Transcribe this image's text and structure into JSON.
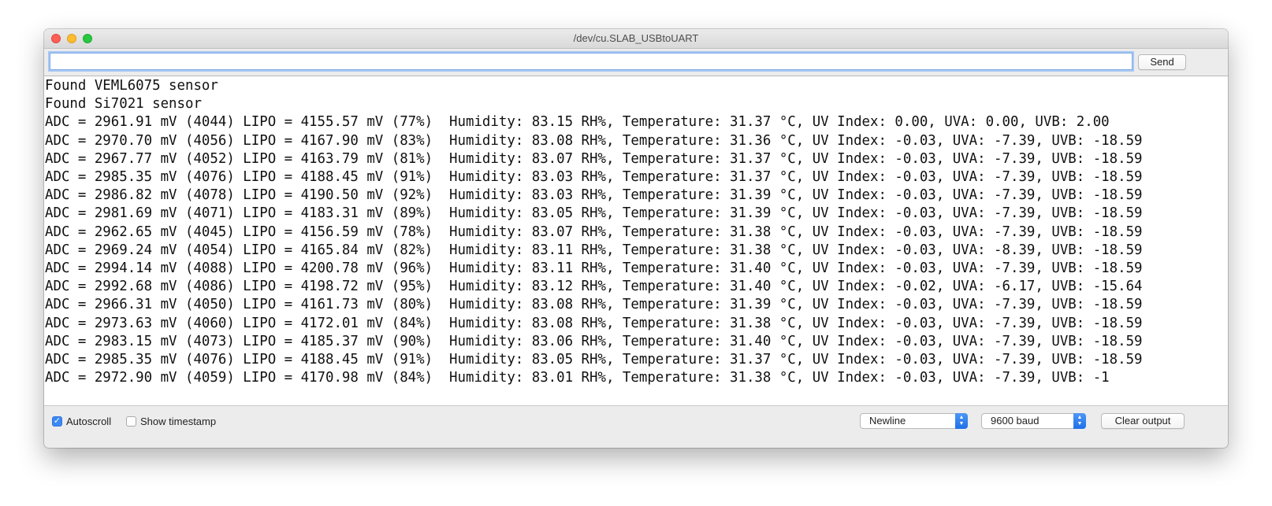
{
  "window": {
    "title": "/dev/cu.SLAB_USBtoUART"
  },
  "send_bar": {
    "input_value": "",
    "send_label": "Send"
  },
  "console": {
    "lines": [
      "Found VEML6075 sensor",
      "Found Si7021 sensor",
      "ADC = 2961.91 mV (4044) LIPO = 4155.57 mV (77%)  Humidity: 83.15 RH%, Temperature: 31.37 °C, UV Index: 0.00, UVA: 0.00, UVB: 2.00",
      "ADC = 2970.70 mV (4056) LIPO = 4167.90 mV (83%)  Humidity: 83.08 RH%, Temperature: 31.36 °C, UV Index: -0.03, UVA: -7.39, UVB: -18.59",
      "ADC = 2967.77 mV (4052) LIPO = 4163.79 mV (81%)  Humidity: 83.07 RH%, Temperature: 31.37 °C, UV Index: -0.03, UVA: -7.39, UVB: -18.59",
      "ADC = 2985.35 mV (4076) LIPO = 4188.45 mV (91%)  Humidity: 83.03 RH%, Temperature: 31.37 °C, UV Index: -0.03, UVA: -7.39, UVB: -18.59",
      "ADC = 2986.82 mV (4078) LIPO = 4190.50 mV (92%)  Humidity: 83.03 RH%, Temperature: 31.39 °C, UV Index: -0.03, UVA: -7.39, UVB: -18.59",
      "ADC = 2981.69 mV (4071) LIPO = 4183.31 mV (89%)  Humidity: 83.05 RH%, Temperature: 31.39 °C, UV Index: -0.03, UVA: -7.39, UVB: -18.59",
      "ADC = 2962.65 mV (4045) LIPO = 4156.59 mV (78%)  Humidity: 83.07 RH%, Temperature: 31.38 °C, UV Index: -0.03, UVA: -7.39, UVB: -18.59",
      "ADC = 2969.24 mV (4054) LIPO = 4165.84 mV (82%)  Humidity: 83.11 RH%, Temperature: 31.38 °C, UV Index: -0.03, UVA: -8.39, UVB: -18.59",
      "ADC = 2994.14 mV (4088) LIPO = 4200.78 mV (96%)  Humidity: 83.11 RH%, Temperature: 31.40 °C, UV Index: -0.03, UVA: -7.39, UVB: -18.59",
      "ADC = 2992.68 mV (4086) LIPO = 4198.72 mV (95%)  Humidity: 83.12 RH%, Temperature: 31.40 °C, UV Index: -0.02, UVA: -6.17, UVB: -15.64",
      "ADC = 2966.31 mV (4050) LIPO = 4161.73 mV (80%)  Humidity: 83.08 RH%, Temperature: 31.39 °C, UV Index: -0.03, UVA: -7.39, UVB: -18.59",
      "ADC = 2973.63 mV (4060) LIPO = 4172.01 mV (84%)  Humidity: 83.08 RH%, Temperature: 31.38 °C, UV Index: -0.03, UVA: -7.39, UVB: -18.59",
      "ADC = 2983.15 mV (4073) LIPO = 4185.37 mV (90%)  Humidity: 83.06 RH%, Temperature: 31.40 °C, UV Index: -0.03, UVA: -7.39, UVB: -18.59",
      "ADC = 2985.35 mV (4076) LIPO = 4188.45 mV (91%)  Humidity: 83.05 RH%, Temperature: 31.37 °C, UV Index: -0.03, UVA: -7.39, UVB: -18.59",
      "ADC = 2972.90 mV (4059) LIPO = 4170.98 mV (84%)  Humidity: 83.01 RH%, Temperature: 31.38 °C, UV Index: -0.03, UVA: -7.39, UVB: -1"
    ]
  },
  "bottom_bar": {
    "autoscroll_label": "Autoscroll",
    "autoscroll_checked": true,
    "timestamp_label": "Show timestamp",
    "timestamp_checked": false,
    "line_ending_selected": "Newline",
    "baud_selected": "9600 baud",
    "clear_label": "Clear output"
  },
  "colors": {
    "close": "#fe5f57",
    "minimize": "#febc2e",
    "maximize": "#28c840",
    "accent": "#3d88f3"
  },
  "icons": {
    "close": "close-icon",
    "minimize": "minimize-icon",
    "maximize": "maximize-icon",
    "checkmark": "checkmark-icon",
    "select_arrows": "chevron-updown-icon"
  }
}
